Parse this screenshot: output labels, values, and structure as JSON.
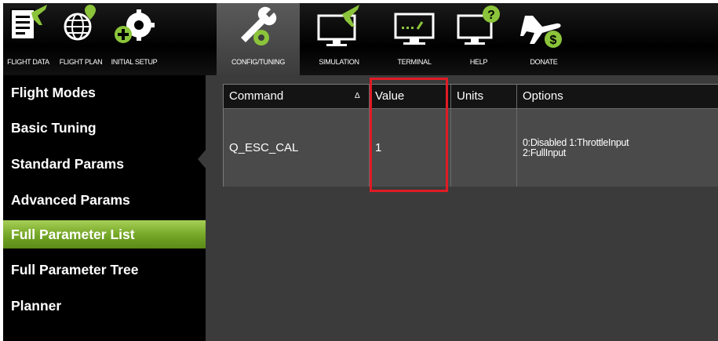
{
  "toolbar": {
    "buttons": [
      {
        "label": "FLIGHT DATA"
      },
      {
        "label": "FLIGHT PLAN"
      },
      {
        "label": "INITIAL SETUP"
      },
      {
        "label": "CONFIG/TUNING"
      },
      {
        "label": "SIMULATION"
      },
      {
        "label": "TERMINAL"
      },
      {
        "label": "HELP"
      },
      {
        "label": "DONATE"
      }
    ]
  },
  "sidebar": {
    "items": [
      {
        "label": "Flight Modes"
      },
      {
        "label": "Basic Tuning"
      },
      {
        "label": "Standard Params"
      },
      {
        "label": "Advanced Params"
      },
      {
        "label": "Full Parameter List"
      },
      {
        "label": "Full Parameter Tree"
      },
      {
        "label": "Planner"
      }
    ],
    "active_index": 4
  },
  "table": {
    "headers": {
      "command": "Command",
      "value": "Value",
      "units": "Units",
      "options": "Options"
    },
    "sort_indicator": "Δ",
    "rows": [
      {
        "command": "Q_ESC_CAL",
        "value": "1",
        "units": "",
        "options_line1": "0:Disabled 1:ThrottleInput",
        "options_line2": "2:FullInput"
      }
    ]
  },
  "colors": {
    "accent_green": "#73a526",
    "highlight_red": "#e01b24"
  }
}
